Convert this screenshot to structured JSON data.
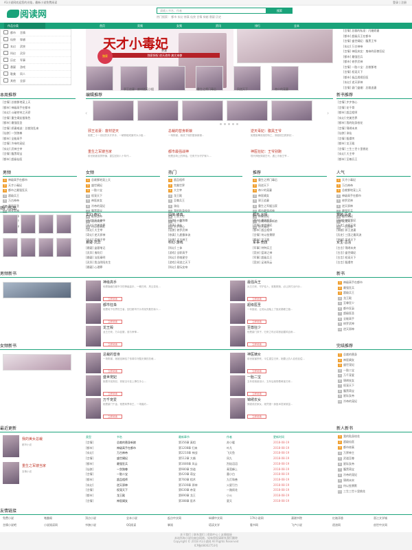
{
  "topbar": {
    "left": "A1小说网欢迎您的光临，最新小说免费阅读",
    "right": "登录 | 注册"
  },
  "logo": {
    "text": "阅读网",
    "color": "#1aa37a"
  },
  "search": {
    "placeholder": "请输入书名、作者",
    "button": "搜索",
    "hot": "热门搜索： 都市 玄幻 修真 仙侠 言情 穿越 悬疑 历史"
  },
  "nav": {
    "items": [
      "作品分类",
      "首页",
      "男频",
      "女频",
      "资讯",
      "排行",
      "全本"
    ]
  },
  "categories": [
    [
      "都市",
      "言情"
    ],
    [
      "仙侠",
      "穿越"
    ],
    [
      "玄幻",
      "武侠"
    ],
    [
      "科幻",
      "灵异"
    ],
    [
      "历史",
      "军事"
    ],
    [
      "悬疑",
      "游戏"
    ],
    [
      "耽美",
      "同人"
    ],
    [
      "其他",
      "全部"
    ]
  ],
  "banner": {
    "title": "天才小毒妃",
    "author": "芥沫",
    "sub": "独家授权 逆天改命 爽文来袭",
    "badge": "独家",
    "color": "#c01010"
  },
  "banner_thumbs": [
    "邪王追妻：废材逆天小姐",
    "重生之将门毒后",
    "凤逆天下",
    "帝少的宠妻",
    "神医嫡女"
  ],
  "top_right_list": [
    "[言情] 总裁的私宠：闪婚娇妻",
    "[都市] 超级兵王在都市",
    "[言情] 盛世嫡妃：腹黑王爷",
    "[玄幻] 万古神帝",
    "[言情] 神医弃女：鬼帝的驭兽狂妃",
    "[都市] 最强狂兵",
    "[都市] 修罗武神",
    "[言情] 一胎二宝：总裁爹地",
    "[言情] 权宠天下",
    "[都市] 极品透视狂医",
    "[玄幻] 逆天邪神",
    "[言情] 豪门盛婚：总裁追妻",
    "[都市] 我的美女总裁老婆"
  ],
  "sections": {
    "update": "本周推荐",
    "editor": "编辑推荐",
    "new": "新书推荐",
    "hotwork": "热门作品",
    "male_new": "男频新书",
    "female_new": "女频新书",
    "finished": "新书",
    "recent": "最近更新",
    "newbook": "新人新书",
    "friends": "友情链接",
    "wanben": "完结推荐"
  },
  "week_list": [
    "[言情] 总裁爹地宠上天",
    "[都市] 神级高手在都市",
    "[玄幻] 斗破苍穹之天骄",
    "[言情] 重生嫡女狠角色",
    "[都市] 最强医圣",
    "[言情] 娇妻难逃：总裁别乱来",
    "[仙侠] 一剑独尊",
    "[都市] 全能高手",
    "[言情] 冷帝的宠妃",
    "[玄幻] 武神主宰",
    "[言情] 腹黑萌宝",
    "[都市] 超级仙医",
    "[言情] 星际女帝"
  ],
  "editor_books": [
    {
      "t": "邪王追妻：废材逆天",
      "d": "她是二十一世纪的天才杀手，一朝穿越成废材大小姐..."
    },
    {
      "t": "总裁的替身新娘",
      "d": "一场阴谋，她成了他的替身新娘..."
    },
    {
      "t": "逆天毒妃：腹黑王爷",
      "d": "她是医毒双绝的特工，穿越成丑颜弃妃..."
    },
    {
      "t": "重生之军嫂当家",
      "d": "前世她被渣男所骗，重生回到八十年代..."
    },
    {
      "t": "都市最强战神",
      "d": "他是战场上的神话，归来只为守护家人..."
    },
    {
      "t": "神医狂妃：王爷别跑",
      "d": "现代神医穿越古代，遇上冷面王爷..."
    }
  ],
  "right_top_list": [
    "[言情] 步步惊心",
    "[言情] 花千骨",
    "[都市] 超品相师",
    "[玄幻] 完美世界",
    "[都市] 我的贴身校花",
    "[言情] 锦绣未央",
    "[仙侠] 诛仙",
    "[言情] 甄嬛传",
    "[都市] 龙王殿",
    "[言情] 三生三世十里桃花",
    "[玄幻] 大主宰",
    "[都市] 至尊兵王",
    "[言情] 何以笙箫默"
  ],
  "rank_cols": [
    {
      "title": "男频",
      "items": [
        "神级高手在都市",
        "天才小毒妃",
        "都市之最强狂兵",
        "超级兵王",
        "万古神帝",
        "最强医圣",
        "修罗武神",
        "逆天邪神",
        "全能高手",
        "武神主宰"
      ]
    },
    {
      "title": "女频",
      "items": [
        "总裁爹地宠上天",
        "盛世嫡妃",
        "一胎二宝",
        "权宠天下",
        "神医弃女",
        "冷帝的宠妃",
        "腹黑萌宝",
        "星际女帝",
        "锦绣未央",
        "何以笙箫默"
      ]
    },
    {
      "title": "热门",
      "items": [
        "超品相师",
        "完美世界",
        "大主宰",
        "龙王殿",
        "至尊兵王",
        "诛仙",
        "我的贴身校花",
        "三生三世",
        "花千骨",
        "步步惊心"
      ]
    },
    {
      "title": "推荐",
      "items": [
        "重生之将门毒后",
        "凤逆天下",
        "帝少的宠妻",
        "神医嫡女",
        "邪王追妻",
        "重生之军嫂当家",
        "都市最强战神",
        "神医狂妃",
        "总裁的替身新娘",
        "逆天毒妃"
      ]
    },
    {
      "title": "人气",
      "items": [
        "天才小毒妃",
        "万古神帝",
        "总裁爹地宠上天",
        "神级高手在都市",
        "修罗武神",
        "逆天邪神",
        "最强狂兵",
        "盛世嫡妃",
        "权宠天下",
        "一剑独尊"
      ]
    }
  ],
  "hot_grid": [
    {
      "title": "玄幻·奇幻",
      "items": [
        "[玄幻] 万古神帝",
        "[玄幻] 完美世界",
        "[玄幻] 大主宰",
        "[奇幻] 逆天邪神",
        "[玄幻] 武神主宰",
        "[玄幻] 斗破苍穹"
      ]
    },
    {
      "title": "仙侠·修真",
      "items": [
        "[仙侠] 一剑独尊",
        "[修真] 诛仙",
        "[仙侠] 修罗武神",
        "[修真] 九星霸体诀",
        "[仙侠] 太古神王",
        "[修真] 剑来"
      ]
    },
    {
      "title": "都市·言情",
      "items": [
        "[都市] 最强狂兵",
        "[言情] 盛世嫡妃",
        "[都市] 超品相师",
        "[言情] 何以笙箫默",
        "[都市] 龙王殿",
        "[言情] 锦绣未央"
      ]
    },
    {
      "title": "穿越·历史",
      "items": [
        "[穿越] 神医狂妃",
        "[历史] 大明王侯",
        "[穿越] 邪王追妻",
        "[历史] 三国之最风流",
        "[穿越] 凤逆天下",
        "[历史] 唐砖"
      ]
    },
    {
      "title": "悬疑·灵异",
      "items": [
        "[悬疑] 盗墓笔记",
        "[灵异] 鬼吹灯",
        "[悬疑] 法医秦明",
        "[灵异] 我当阴阳先生",
        "[悬疑] 心理罪",
        "[灵异] 茅山术"
      ]
    },
    {
      "title": "科幻·游戏",
      "items": [
        "[科幻] 三体",
        "[游戏] 全职高手",
        "[科幻] 吞噬星空",
        "[游戏] 网游之天下",
        "[科幻] 星际女帝",
        "[游戏] 王者时刻"
      ]
    },
    {
      "title": "军事·竞技",
      "items": [
        "[军事] 特种兵王",
        "[竞技] 篮球之神",
        "[军事] 超级兵王",
        "[竞技] 足球风云"
      ]
    },
    {
      "title": "女生·古言",
      "items": [
        "[古言] 锦绣未央",
        "[古言] 盛世嫡妃",
        "[古言] 权宠天下",
        "[古言] 甄嬛传"
      ]
    },
    {
      "title": "耽美·同人",
      "items": [
        "[同人] 综漫之王",
        "[耽美] 盛世帝王",
        "[同人] 火影之最强",
        "[耽美] 将军在上"
      ]
    },
    {
      "title": "武侠·其他",
      "items": [
        "[武侠] 射雕英雄传",
        "[武侠] 天龙八部",
        "[其他] 明朝那些事",
        "[其他] 平凡的世界"
      ]
    }
  ],
  "male_books": [
    {
      "t": "神级高手",
      "d": "他是隐藏在都市中的神级高手，一朝归来，风云变色...",
      "b": "立即阅读"
    },
    {
      "t": "最强兵王",
      "d": "兵王归来，守护佳人，谁敢欺她，必让其付出代价...",
      "b": "立即阅读"
    },
    {
      "t": "都市狂枭",
      "d": "他是地下世界的王者，回归都市只为寻找失散的亲人...",
      "b": "立即阅读"
    },
    {
      "t": "超级医圣",
      "d": "一本医经，让他从此踏上了医武巅峰之路...",
      "b": "立即阅读"
    },
    {
      "t": "龙王殿",
      "d": "龙王归来，万众臣服，谁与争锋...",
      "b": "立即阅读"
    },
    {
      "t": "至尊狂少",
      "d": "他是豪门弃子，归来之时必将掀起腥风血雨...",
      "b": "立即阅读"
    }
  ],
  "female_books": [
    {
      "t": "总裁的替身",
      "d": "一场阴谋，她被迫嫁给了传闻中冷酷无情的总裁...",
      "b": "立即阅读"
    },
    {
      "t": "神医嫡女",
      "d": "前世被害惨死，今生重生归来，她要让仇人血债血偿...",
      "b": "立即阅读"
    },
    {
      "t": "盛世宠妃",
      "d": "她是冷宫弃妃，却被当今圣上捧在手心...",
      "b": "立即阅读"
    },
    {
      "t": "一胎二宝",
      "d": "五年前她被设计，五年后她带着萌宝归来...",
      "b": "立即阅读"
    },
    {
      "t": "万千宠爱",
      "d": "她是豪门千金，他是商界帝王，一场婚约...",
      "b": "立即阅读"
    },
    {
      "t": "锦绣农女",
      "d": "穿越成农家女，她凭借一身医术发家致富...",
      "b": "立即阅读"
    }
  ],
  "male_side": [
    "神级高手在都市",
    "最强狂兵",
    "超级兵王",
    "龙王殿",
    "至尊狂少",
    "都市狂枭",
    "超级医圣",
    "全能高手",
    "修罗武神",
    "逆天邪神"
  ],
  "female_side": [
    "总裁的替身",
    "神医嫡女",
    "盛世宠妃",
    "一胎二宝",
    "万千宠爱",
    "锦绣农女",
    "权宠天下",
    "腹黑萌宝",
    "星际女帝",
    "冷帝的宠妃"
  ],
  "recent_cols": [
    "类型",
    "书名",
    "最新章节",
    "作者",
    "更新时间"
  ],
  "recent_rows": [
    [
      "[言情]",
      "总裁的替身新娘",
      "第356章 真相",
      "苏小暖",
      "2018-08-19"
    ],
    [
      "[都市]",
      "神级高手在都市",
      "第1208章 归来",
      "叶凡",
      "2018-08-19"
    ],
    [
      "[玄幻]",
      "万古神帝",
      "第2210章 神战",
      "飞天鱼",
      "2018-08-19"
    ],
    [
      "[言情]",
      "盛世嫡妃",
      "第512章 大婚",
      "凤九",
      "2018-08-19"
    ],
    [
      "[都市]",
      "最强狂兵",
      "第1680章 风云",
      "烈焰滔滔",
      "2018-08-19"
    ],
    [
      "[仙侠]",
      "一剑独尊",
      "第980章 剑道",
      "青鸾峰上",
      "2018-08-19"
    ],
    [
      "[言情]",
      "一胎二宝",
      "第420章 萌宝",
      "墨小白",
      "2018-08-19"
    ],
    [
      "[都市]",
      "超品相师",
      "第760章 相术",
      "九灯和善",
      "2018-08-19"
    ],
    [
      "[玄幻]",
      "逆天邪神",
      "第1500章 邪神",
      "火星引力",
      "2018-08-19"
    ],
    [
      "[言情]",
      "权宠天下",
      "第630章 帝宠",
      "一路烦花",
      "2018-08-19"
    ],
    [
      "[都市]",
      "龙王殿",
      "第890章 龙王",
      "小火",
      "2018-08-19"
    ],
    [
      "[言情]",
      "神医嫡女",
      "第388章 医术",
      "夏天",
      "2018-08-19"
    ]
  ],
  "recent_side": [
    {
      "t": "我的美女总裁",
      "d": "都市小说"
    },
    {
      "t": "重生之军嫂当家",
      "d": "言情小说"
    }
  ],
  "newbook_list": [
    "我的贴身校花",
    "超级仙医",
    "都市修真",
    "万界神主",
    "武道至尊",
    "星际女帝",
    "腹黑萌宝",
    "冷帝的宠妃",
    "锦绣未央",
    "何以笙箫默",
    "三生三世十里桃花"
  ],
  "friend_links": [
    "免费小说",
    "笔趣阁",
    "顶点小说",
    "全本小说",
    "起点中文网",
    "纵横中文网",
    "17K小说网",
    "潇湘书院",
    "红袖添香",
    "晋江文学城",
    "言情小说吧",
    "小说阅读网",
    "书旗小说",
    "QQ阅读",
    "掌阅",
    "塔读文学",
    "看书网",
    "飞卢小说",
    "逐浪网",
    "创世中文网"
  ],
  "footer": {
    "links": "关于我们 | 联系我们 | 帮助中心 | 友情链接",
    "l1": "本站所有小说均来自网络，如有侵权请联系我们删除",
    "l2": "Copyright © 2018 A1小说网 All Rights Reserved",
    "icp": "ICP备08002753号"
  }
}
